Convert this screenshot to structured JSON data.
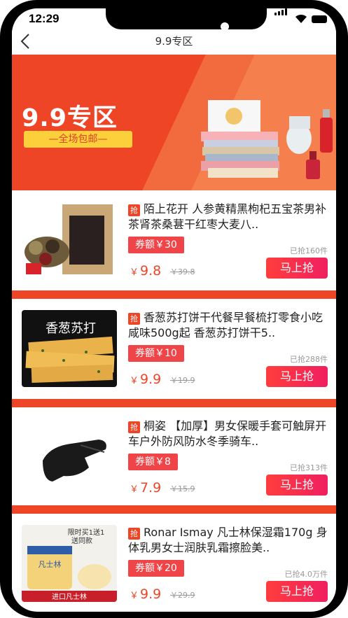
{
  "status": {
    "time": "12:29"
  },
  "nav": {
    "back_icon": "chevron-left-icon",
    "title": "9.9专区"
  },
  "banner": {
    "title": "9.9专区",
    "badge": "—全场包邮—"
  },
  "products": [
    {
      "tag": "抢",
      "title": "陌上花开 人参黄精黑枸杞五宝茶男补茶肾茶桑葚干红枣大麦八..",
      "coupon": "券额￥30",
      "sold": "已抢160件",
      "currency": "￥",
      "price": "9.8",
      "original": "￥39.8",
      "button": "马上抢"
    },
    {
      "tag": "抢",
      "title": "香葱苏打饼干代餐早餐梳打零食小吃咸味500g起 香葱苏打饼干5..",
      "coupon": "券额￥10",
      "sold": "已抢288件",
      "currency": "￥",
      "price": "9.9",
      "original": "￥19.9",
      "button": "马上抢"
    },
    {
      "tag": "抢",
      "title": "桐姿 【加厚】男女保暖手套可触屏开车户外防风防水冬季骑车..",
      "coupon": "券额￥8",
      "sold": "已抢313件",
      "currency": "￥",
      "price": "7.9",
      "original": "￥15.9",
      "button": "马上抢"
    },
    {
      "tag": "抢",
      "title": "Ronar Ismay 凡士林保湿霜170g 身体乳男女士润肤乳霜擦脸美..",
      "coupon": "券额￥20",
      "sold": "已抢4.0万件",
      "currency": "￥",
      "price": "9.9",
      "original": "￥29.9",
      "button": "马上抢"
    }
  ],
  "thumb_text": {
    "p2_brand": "香葱苏打",
    "p4_promo1": "限时买1送1",
    "p4_promo2": "送同款",
    "p4_jar": "凡士林",
    "p4_caption": "进口凡士林"
  },
  "colors": {
    "accent": "#ef4527",
    "coupon": "#ef4548",
    "badge": "#fcd03a"
  }
}
